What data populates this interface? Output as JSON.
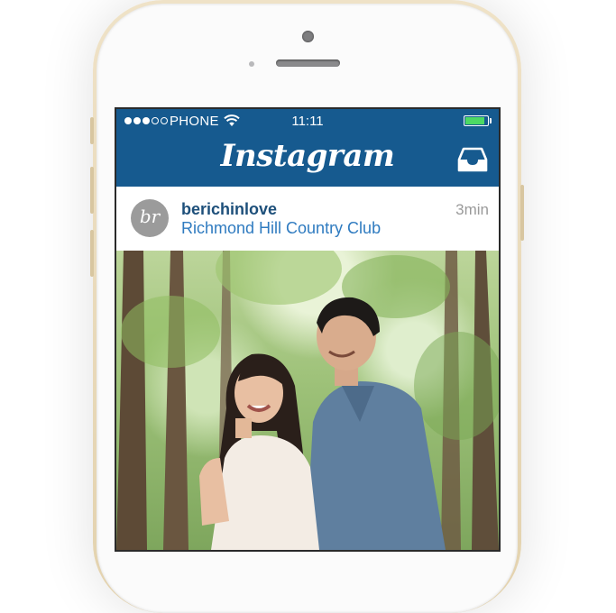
{
  "status_bar": {
    "carrier": "PHONE",
    "time": "11:11",
    "signal_bars_filled": 3,
    "signal_bars_total": 5,
    "battery_level": 0.9,
    "battery_color": "#4cd964"
  },
  "nav_bar": {
    "title": "Instagram",
    "background": "#165a8f",
    "inbox_icon": "inbox-tray-icon"
  },
  "post": {
    "avatar_text": "br",
    "username": "berichinlove",
    "location": "Richmond Hill Country Club",
    "time_ago": "3min",
    "photo_subject": "couple-in-forest-photo"
  },
  "colors": {
    "username": "#1d4f7a",
    "location": "#2f7bc0",
    "phone_frame": "#e3d2ae"
  }
}
